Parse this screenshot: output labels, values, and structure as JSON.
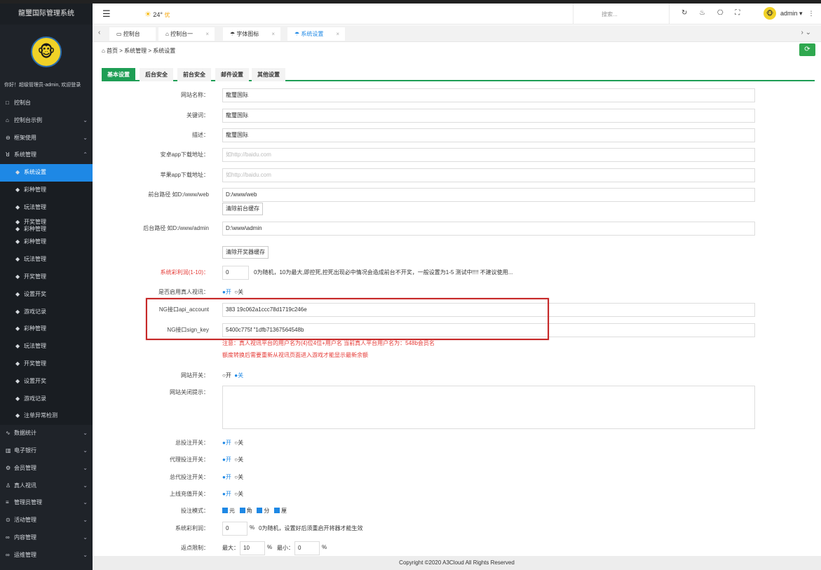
{
  "sidebar": {
    "brand": "龍璽国际管理系统",
    "avatar": "🐵",
    "welcome": "你好！超级管理员-admin, 欢迎登录",
    "items": [
      {
        "icon": "□",
        "label": "控制台",
        "chev": ""
      },
      {
        "icon": "⌂",
        "label": "控制台示例",
        "chev": "⌄"
      },
      {
        "icon": "⊖",
        "label": "框架使用",
        "chev": "⌄"
      },
      {
        "icon": "ꓤ",
        "label": "系统管理",
        "chev": "⌃"
      },
      {
        "icon": "◆",
        "label": "系统设置",
        "chev": ""
      },
      {
        "icon": "◆",
        "label": "彩种管理",
        "chev": ""
      },
      {
        "icon": "◆",
        "label": "玩法管理",
        "chev": ""
      },
      {
        "icon": "◆",
        "label": "开奖管理",
        "label2": "彩种管理",
        "chev": ""
      },
      {
        "icon": "◆",
        "label": "彩种管理",
        "chev": ""
      },
      {
        "icon": "◆",
        "label": "玩法管理",
        "chev": ""
      },
      {
        "icon": "◆",
        "label": "开奖管理",
        "chev": ""
      },
      {
        "icon": "◆",
        "label": "设置开奖",
        "chev": ""
      },
      {
        "icon": "◆",
        "label": "游戏记录",
        "chev": ""
      },
      {
        "icon": "◆",
        "label": "彩种管理",
        "chev": ""
      },
      {
        "icon": "◆",
        "label": "玩法管理",
        "chev": ""
      },
      {
        "icon": "◆",
        "label": "开奖管理",
        "chev": ""
      },
      {
        "icon": "◆",
        "label": "设置开奖",
        "chev": ""
      },
      {
        "icon": "◆",
        "label": "游戏记录",
        "chev": ""
      },
      {
        "icon": "◆",
        "label": "注单异常检测",
        "chev": ""
      },
      {
        "icon": "∿",
        "label": "数据统计",
        "chev": "⌄"
      },
      {
        "icon": "▥",
        "label": "电子银行",
        "chev": "⌄"
      },
      {
        "icon": "⚙",
        "label": "会员管理",
        "chev": "⌄"
      },
      {
        "icon": "♙",
        "label": "真人视讯",
        "chev": "⌄"
      },
      {
        "icon": "≡",
        "label": "管理员管理",
        "chev": "⌄"
      },
      {
        "icon": "⊙",
        "label": "活动管理",
        "chev": "⌄"
      },
      {
        "icon": "∞",
        "label": "内容管理",
        "chev": "⌄"
      },
      {
        "icon": "∞",
        "label": "运维管理",
        "chev": "⌄"
      }
    ]
  },
  "header": {
    "menu_icon": "☰",
    "weather_temp": "24°",
    "weather_quality": "优",
    "search_placeholder": "搜索...",
    "icons": "↻ ♨ ⎔ ⛶",
    "admin": "admin ▾",
    "more": "⋮"
  },
  "tabs": [
    {
      "icon": "▭",
      "label": "控制台",
      "close": ""
    },
    {
      "icon": "⌂",
      "label": "控制台一",
      "close": "×"
    },
    {
      "icon": "☂",
      "label": "字体图标",
      "close": "×"
    },
    {
      "icon": "☂",
      "label": "系统设置",
      "close": "×"
    }
  ],
  "tab_nav": {
    "prev": "‹",
    "next": "› ⌄"
  },
  "breadcrumb": "⌂ 首页 > 系统管理 > 系统设置",
  "refresh_icon": "⟳",
  "content_tabs": [
    "基本设置",
    "后台安全",
    "前台安全",
    "邮件设置",
    "其他设置"
  ],
  "form": {
    "site_name": {
      "label": "网站名称：",
      "value": "龍璽国际"
    },
    "keywords": {
      "label": "关键词：",
      "value": "龍璽国际"
    },
    "description": {
      "label": "描述：",
      "value": "龍璽国际"
    },
    "android_url": {
      "label": "安卓app下载地址：",
      "placeholder": "如http://baidu.com"
    },
    "apple_url": {
      "label": "苹果app下载地址：",
      "placeholder": "如http://baidu.com"
    },
    "front_path": {
      "label": "前台路径 如D:/www/web",
      "value": "D:/www/web",
      "button": "清除前台缓存"
    },
    "back_path": {
      "label": "后台路径 如D:/www/admin",
      "value": "D:\\www\\admin",
      "button": "清除开奖器缓存"
    },
    "profit_rate": {
      "label": "系统彩利润(1-10)：",
      "value": "0",
      "hint": "0为随机，10为最大,即控死,控死出现必中情况会造成前台不开奖，一般设置为1-5 测试中!!!! 不建议使用..."
    },
    "live_video": {
      "label": "是否启用真人视讯：",
      "on": "●开",
      "off": "○关"
    },
    "ng_account": {
      "label": "NG接口api_account",
      "value": "383          19c062a1ccc78d1719c246e"
    },
    "ng_key": {
      "label": "NG接口sign_key",
      "value": "5400c775f          \"1dfb71367564548b"
    },
    "note1": "注意：真人视讯平台的用户名为(4)位4位+用户名 当前真人平台用户名为：548b会员名",
    "note2": "额度转换后需要重新从视讯页面进入游戏才能显示最新余额",
    "site_switch": {
      "label": "网站开关：",
      "on": "○开",
      "off": "●关"
    },
    "close_notice": {
      "label": "网站关闭提示："
    },
    "total_bet": {
      "label": "总投注开关：",
      "on": "●开",
      "off": "○关"
    },
    "agent_bet": {
      "label": "代理投注开关：",
      "on": "●开",
      "off": "○关"
    },
    "general_agent_bet": {
      "label": "总代投注开关：",
      "on": "●开",
      "off": "○关"
    },
    "online_recharge": {
      "label": "上线充值开关：",
      "on": "●开",
      "off": "○关"
    },
    "bet_mode": {
      "label": "投注模式：",
      "options": [
        "元",
        "角",
        "分",
        "厘"
      ]
    },
    "profit_rate2": {
      "label": "系统彩利润：",
      "value": "0",
      "unit": "%",
      "hint": "0为随机，设置好后须重启开将器才能生效"
    },
    "rebate": {
      "label": "返点限制：",
      "max_label": "最大：",
      "max": "10",
      "min_label": "最小：",
      "min": "0",
      "unit": "%"
    }
  },
  "footer": "Copyright ©2020 A3Cloud All Rights Reserved",
  "colors": {
    "sidebar": "#1f2329",
    "active": "#1e88e5",
    "green": "#1e9e55",
    "highlight": "#c62828"
  }
}
